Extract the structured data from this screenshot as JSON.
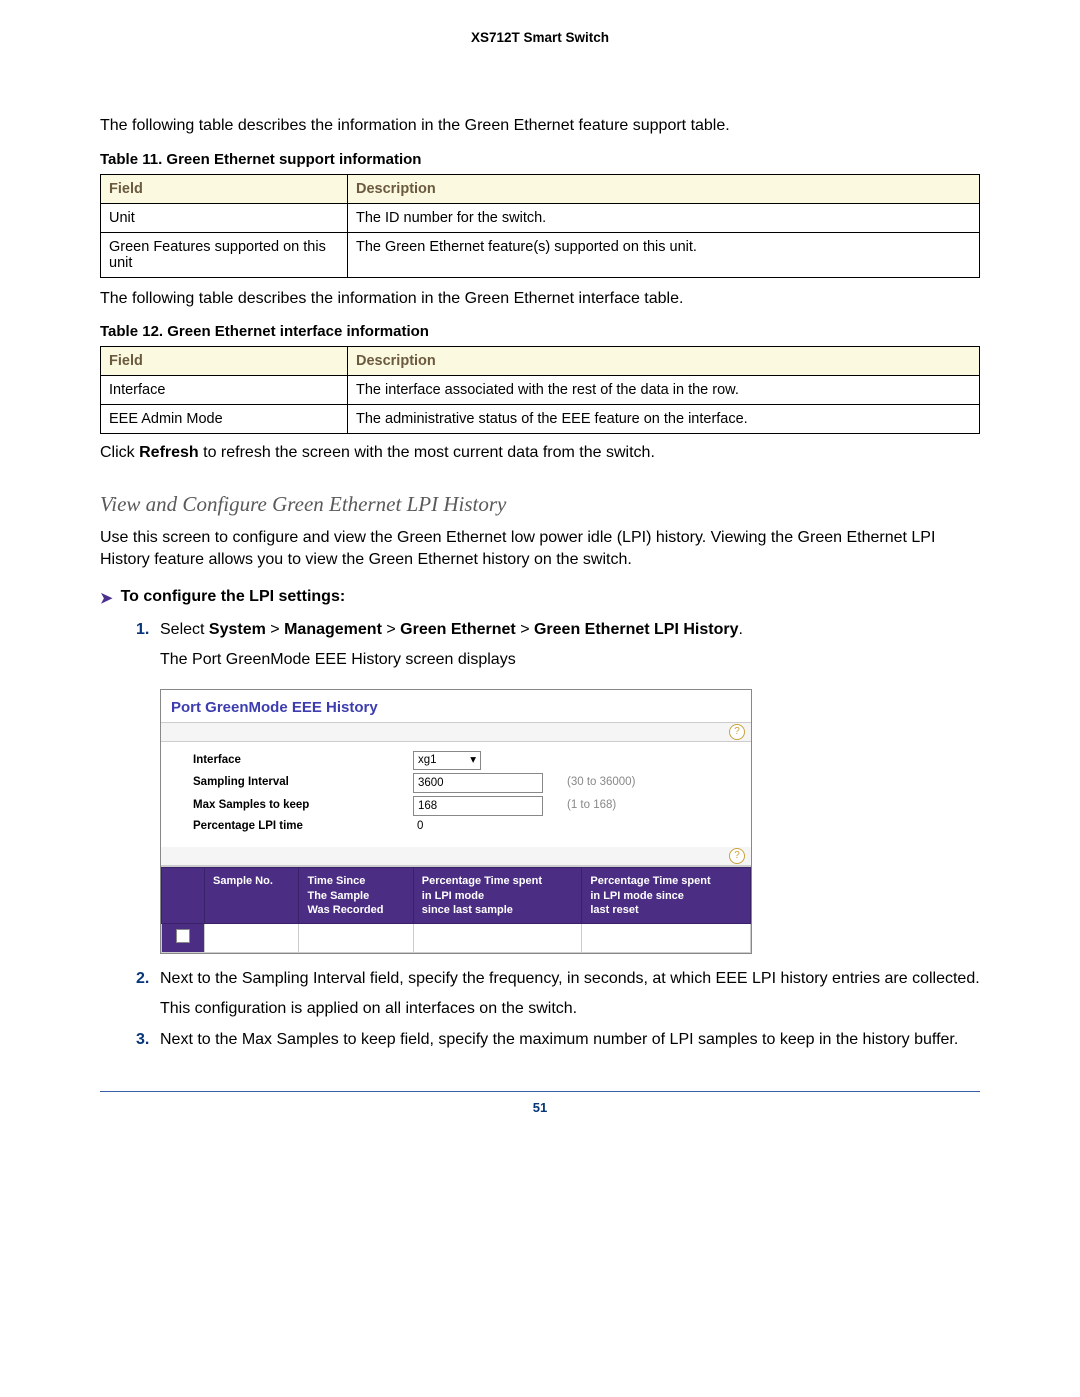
{
  "header": {
    "product": "XS712T Smart Switch"
  },
  "intro1": "The following table describes the information in the Green Ethernet feature support table.",
  "table11": {
    "caption": "Table 11.  Green Ethernet support information",
    "head": {
      "field": "Field",
      "desc": "Description"
    },
    "rows": [
      {
        "field": "Unit",
        "desc": "The ID number for the switch."
      },
      {
        "field": "Green Features supported on this unit",
        "desc": "The Green Ethernet feature(s) supported on this unit."
      }
    ]
  },
  "intro2": "The following table describes the information in the Green Ethernet interface table.",
  "table12": {
    "caption": "Table 12.  Green Ethernet interface information",
    "head": {
      "field": "Field",
      "desc": "Description"
    },
    "rows": [
      {
        "field": "Interface",
        "desc": "The interface associated with the rest of the data in the row."
      },
      {
        "field": "EEE Admin Mode",
        "desc": "The administrative status of the EEE feature on the interface."
      }
    ]
  },
  "refresh": {
    "pre": "Click ",
    "bold": "Refresh",
    "post": " to refresh the screen with the most current data from the switch."
  },
  "section": {
    "title": "View and Configure Green Ethernet LPI History"
  },
  "section_intro": "Use this screen to configure and view the Green Ethernet low power idle (LPI) history. Viewing the Green Ethernet LPI History feature allows you to view the Green Ethernet history on the switch.",
  "procedure": {
    "lead": "To configure the LPI settings:",
    "step1": {
      "pre": "Select ",
      "path": [
        "System",
        "Management",
        "Green Ethernet",
        "Green Ethernet LPI History"
      ],
      "sep": ">",
      "sub": "The Port GreenMode EEE History screen displays"
    },
    "step2": {
      "main": "Next to the Sampling Interval field, specify the frequency, in seconds, at which EEE LPI history entries are collected.",
      "sub": "This configuration is applied on all interfaces on the switch."
    },
    "step3": {
      "main": "Next to the Max Samples to keep field, specify the maximum number of LPI samples to keep in the history buffer."
    }
  },
  "panel": {
    "title": "Port GreenMode EEE History",
    "fields": {
      "interface": {
        "label": "Interface",
        "value": "xg1"
      },
      "sampling": {
        "label": "Sampling Interval",
        "value": "3600",
        "hint": "(30 to 36000)"
      },
      "max": {
        "label": "Max Samples to keep",
        "value": "168",
        "hint": "(1 to 168)"
      },
      "pct": {
        "label": "Percentage LPI time",
        "value": "0"
      }
    },
    "table_head": {
      "c1": "Sample No.",
      "c2a": "Time Since",
      "c2b": "The Sample",
      "c2c": "Was Recorded",
      "c3a": "Percentage Time spent",
      "c3b": "in LPI mode",
      "c3c": "since last sample",
      "c4a": "Percentage Time spent",
      "c4b": "in LPI mode since",
      "c4c": "last reset"
    }
  },
  "page_number": "51"
}
